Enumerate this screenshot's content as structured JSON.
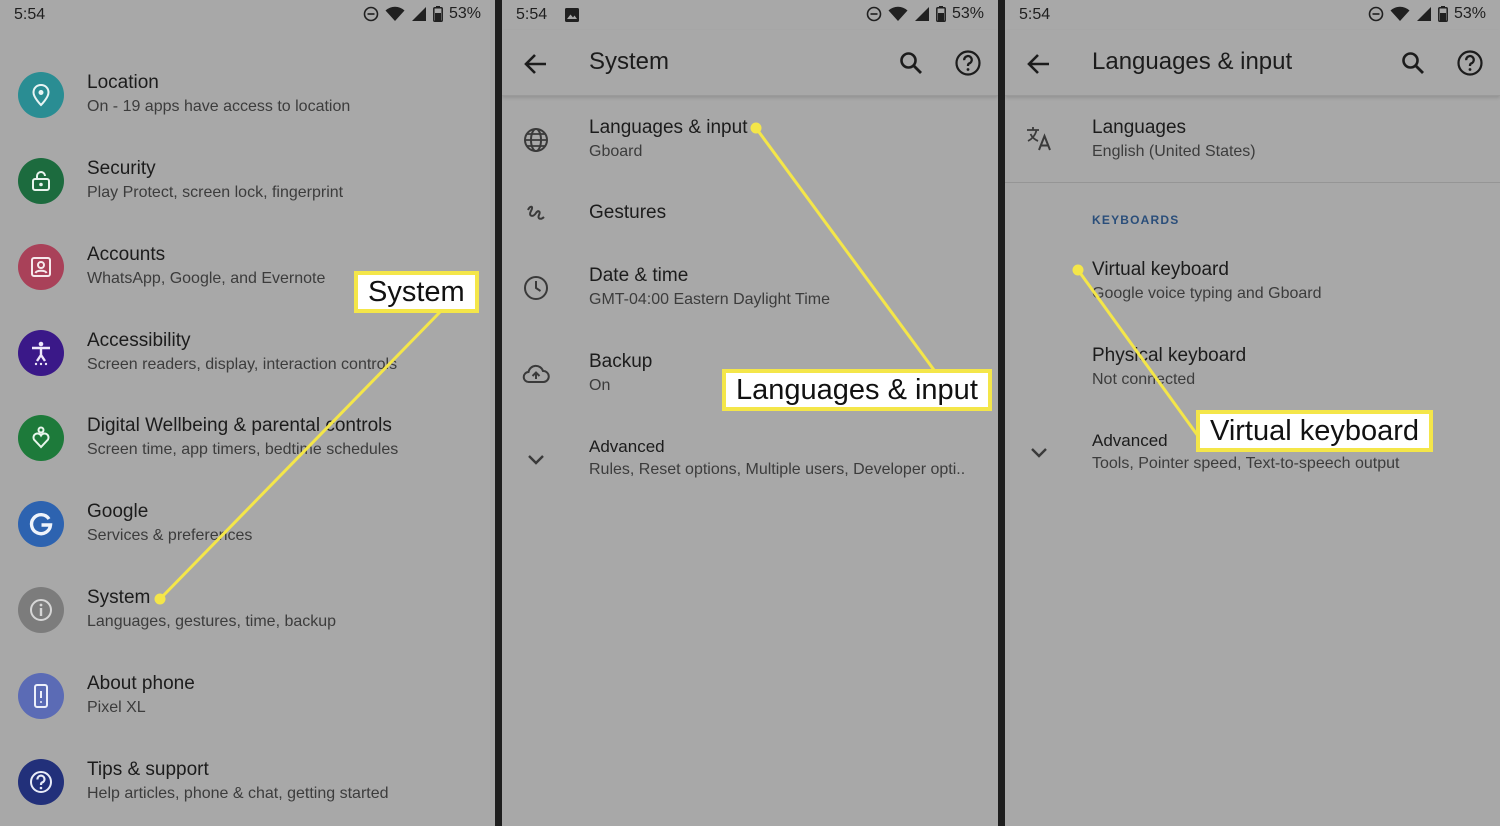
{
  "status": {
    "time": "5:54",
    "battery": "53%"
  },
  "panel1": {
    "items": [
      {
        "title": "Location",
        "subtitle": "On - 19 apps have access to location"
      },
      {
        "title": "Security",
        "subtitle": "Play Protect, screen lock, fingerprint"
      },
      {
        "title": "Accounts",
        "subtitle": "WhatsApp, Google, and Evernote"
      },
      {
        "title": "Accessibility",
        "subtitle": "Screen readers, display, interaction controls"
      },
      {
        "title": "Digital Wellbeing & parental controls",
        "subtitle": "Screen time, app timers, bedtime schedules"
      },
      {
        "title": "Google",
        "subtitle": "Services & preferences"
      },
      {
        "title": "System",
        "subtitle": "Languages, gestures, time, backup"
      },
      {
        "title": "About phone",
        "subtitle": "Pixel XL"
      },
      {
        "title": "Tips & support",
        "subtitle": "Help articles, phone & chat, getting started"
      }
    ],
    "callout": "System"
  },
  "panel2": {
    "title": "System",
    "items": [
      {
        "title": "Languages & input",
        "subtitle": "Gboard"
      },
      {
        "title": "Gestures",
        "subtitle": ""
      },
      {
        "title": "Date & time",
        "subtitle": "GMT-04:00 Eastern Daylight Time"
      },
      {
        "title": "Backup",
        "subtitle": "On"
      },
      {
        "title": "Advanced",
        "subtitle": "Rules, Reset options, Multiple users, Developer opti.."
      }
    ],
    "callout": "Languages & input"
  },
  "panel3": {
    "title": "Languages & input",
    "items": [
      {
        "title": "Languages",
        "subtitle": "English (United States)"
      },
      {
        "title": "Virtual keyboard",
        "subtitle": "Google voice typing and Gboard"
      },
      {
        "title": "Physical keyboard",
        "subtitle": "Not connected"
      },
      {
        "title": "Advanced",
        "subtitle": "Tools, Pointer speed, Text-to-speech output"
      }
    ],
    "section_header": "KEYBOARDS",
    "callout": "Virtual keyboard"
  },
  "colors": {
    "panel_bg": "#a8a8a8",
    "highlight": "#f4e649",
    "location_icon": "#2a8d93",
    "security_icon": "#1c6b3e",
    "accounts_icon": "#a94159",
    "accessibility_icon": "#3a1888",
    "wellbeing_icon": "#1d7a3a",
    "google_icon": "#2d63b0",
    "system_icon": "#7c7c7c",
    "about_icon": "#5b6bb5",
    "tips_icon": "#22307a"
  },
  "icons": {
    "panel1": [
      "location-pin-icon",
      "lock-icon",
      "account-box-icon",
      "accessibility-icon",
      "wellbeing-icon",
      "google-g-icon",
      "info-icon",
      "phone-icon",
      "help-icon"
    ],
    "panel2": [
      "globe-icon",
      "gesture-icon",
      "clock-icon",
      "cloud-upload-icon",
      "chevron-down-icon"
    ],
    "panel3": [
      "translate-icon",
      "chevron-down-icon"
    ]
  }
}
